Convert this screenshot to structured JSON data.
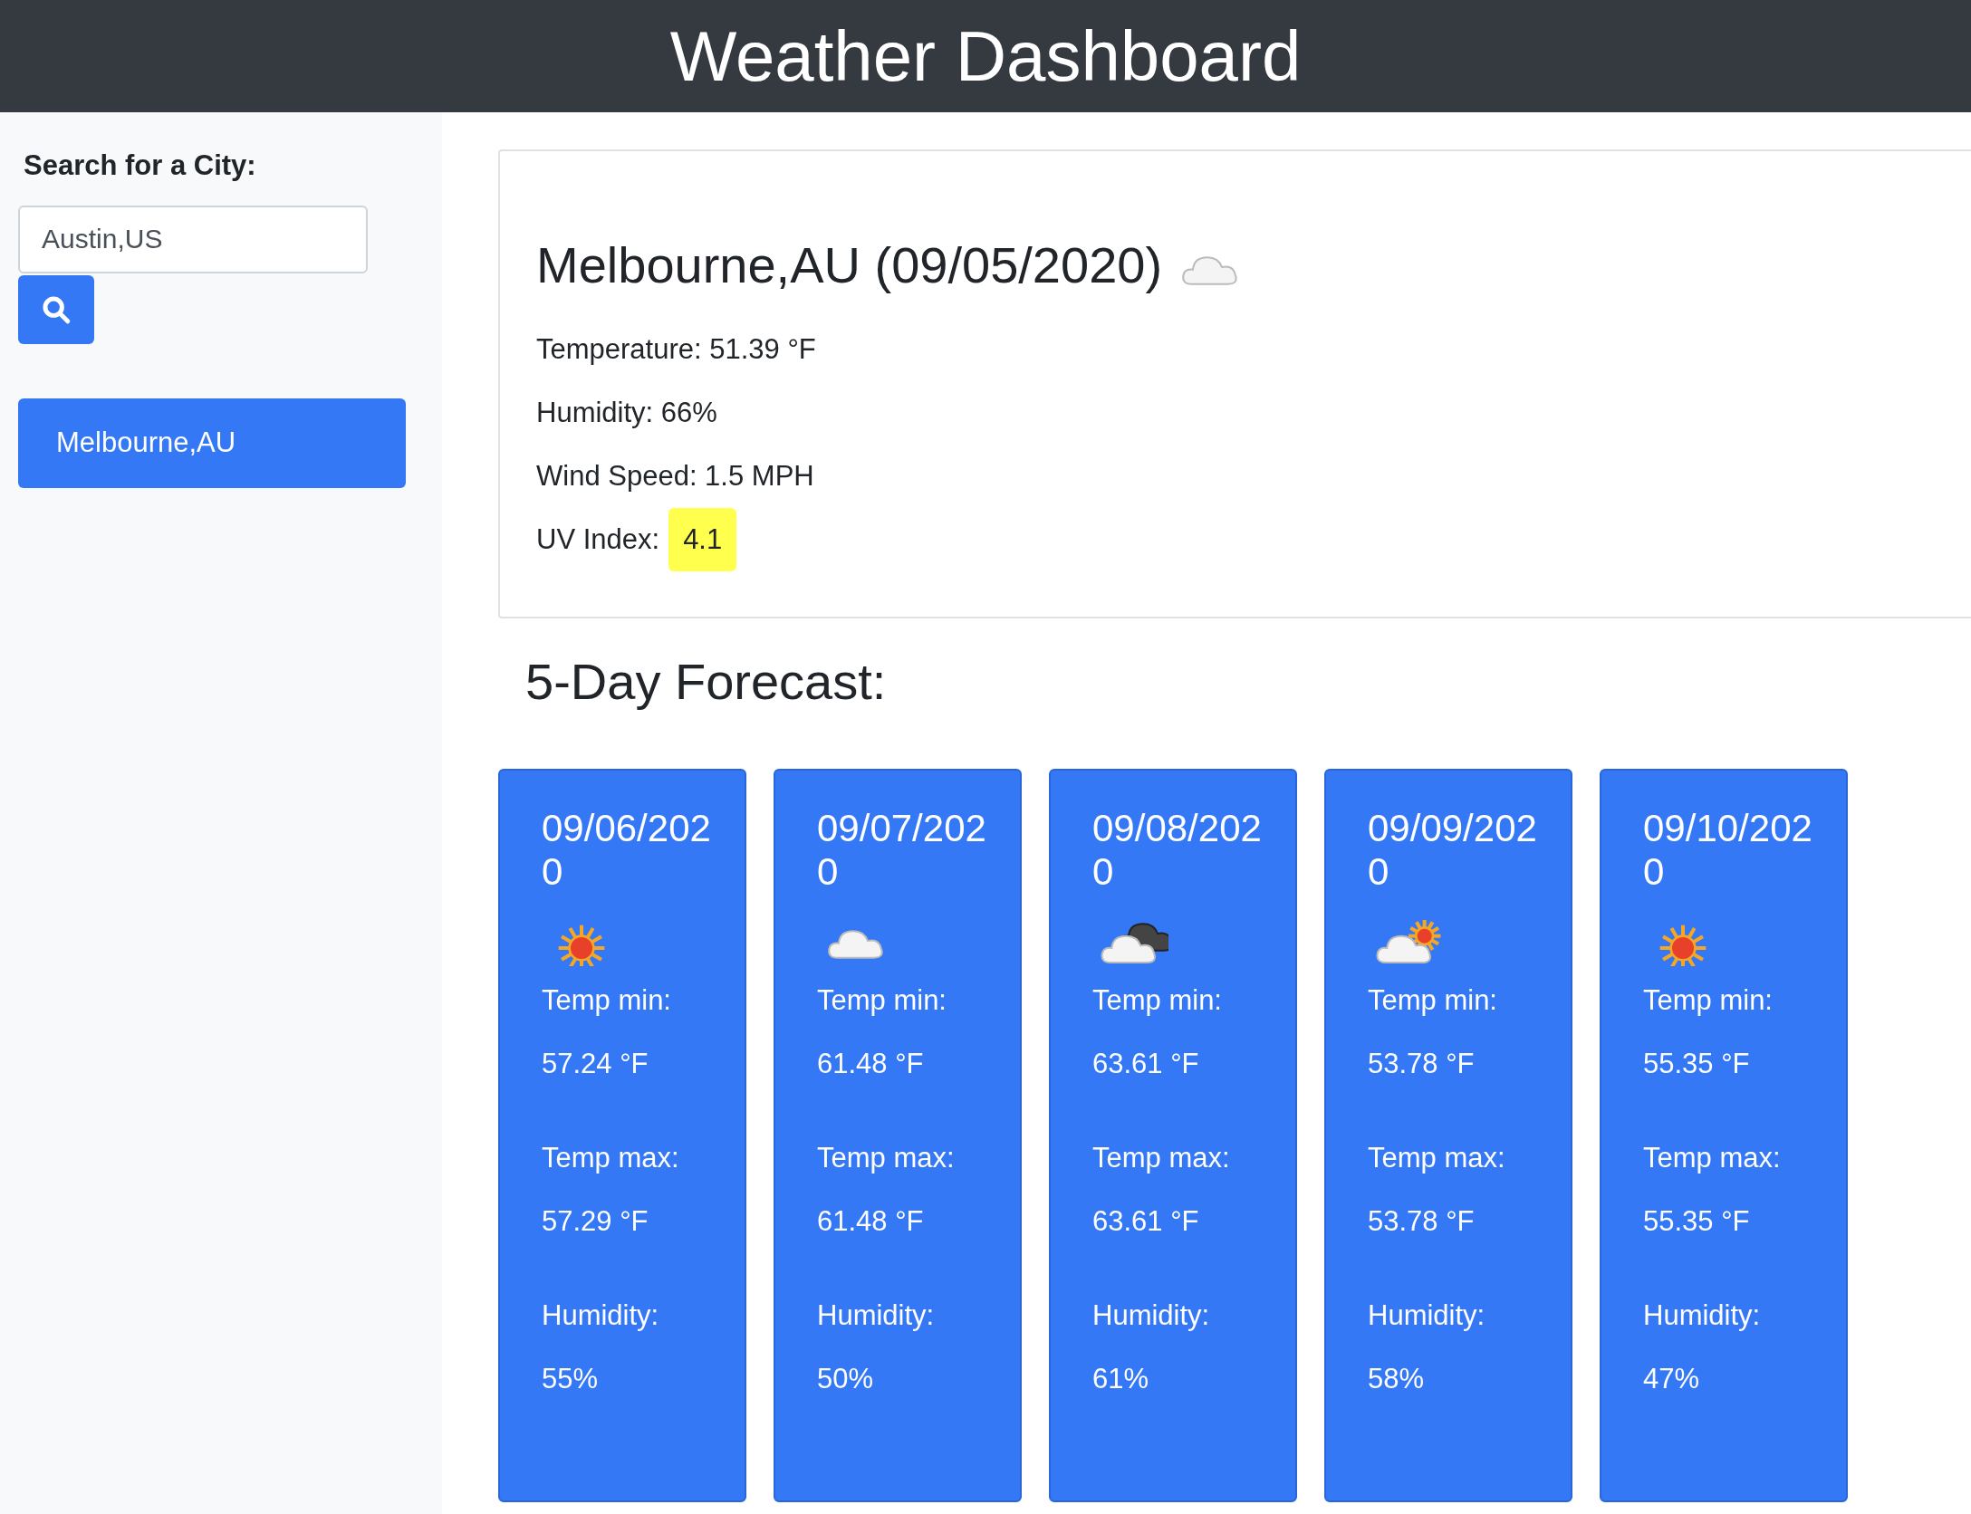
{
  "header": {
    "title": "Weather Dashboard"
  },
  "sidebar": {
    "label": "Search for a City:",
    "search": {
      "value": "Austin,US"
    },
    "history": [
      {
        "city": "Melbourne,AU"
      }
    ]
  },
  "current": {
    "title": "Melbourne,AU (09/05/2020)",
    "icon": {
      "kind": "cloud"
    },
    "lines": [
      "Temperature: 51.39 °F",
      "Humidity: 66%",
      "Wind Speed: 1.5 MPH"
    ],
    "uv_label": "UV Index:",
    "uv_value": "4.1"
  },
  "forecast": {
    "title": "5-Day Forecast:",
    "days": [
      {
        "date": "09/06/2020",
        "icon": {
          "kind": "sun"
        },
        "min_label": "Temp min:",
        "min": "57.24 °F",
        "max_label": "Temp max:",
        "max": "57.29 °F",
        "humidity_label": "Humidity:",
        "humidity": "55%"
      },
      {
        "date": "09/07/2020",
        "icon": {
          "kind": "cloud"
        },
        "min_label": "Temp min:",
        "min": "61.48 °F",
        "max_label": "Temp max:",
        "max": "61.48 °F",
        "humidity_label": "Humidity:",
        "humidity": "50%"
      },
      {
        "date": "09/08/2020",
        "icon": {
          "kind": "dark-cloud"
        },
        "min_label": "Temp min:",
        "min": "63.61 °F",
        "max_label": "Temp max:",
        "max": "63.61 °F",
        "humidity_label": "Humidity:",
        "humidity": "61%"
      },
      {
        "date": "09/09/2020",
        "icon": {
          "kind": "sun-cloud"
        },
        "min_label": "Temp min:",
        "min": "53.78 °F",
        "max_label": "Temp max:",
        "max": "53.78 °F",
        "humidity_label": "Humidity:",
        "humidity": "58%"
      },
      {
        "date": "09/10/2020",
        "icon": {
          "kind": "sun"
        },
        "min_label": "Temp min:",
        "min": "55.35 °F",
        "max_label": "Temp max:",
        "max": "55.35 °F",
        "humidity_label": "Humidity:",
        "humidity": "47%"
      }
    ]
  }
}
